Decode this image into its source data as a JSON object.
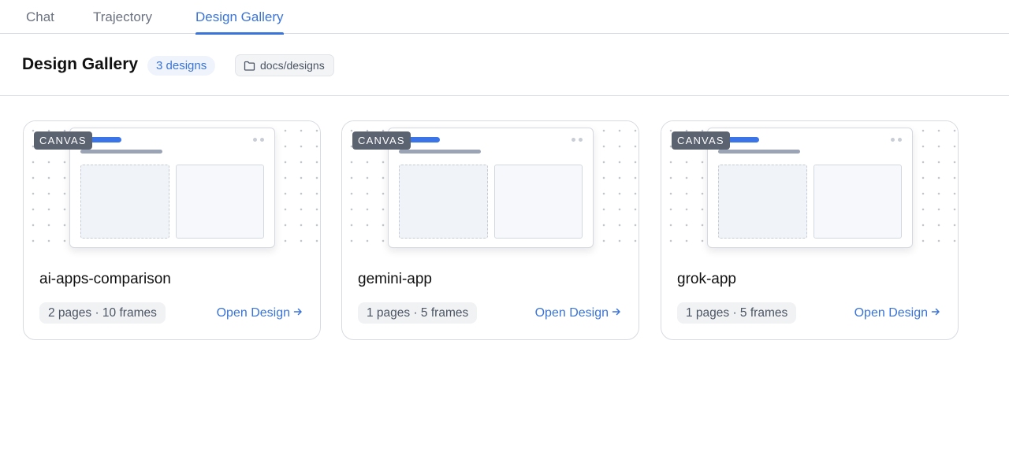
{
  "tabs": [
    {
      "label": "Chat",
      "active": false
    },
    {
      "label": "Trajectory",
      "active": false
    },
    {
      "label": "Design Gallery",
      "active": true
    }
  ],
  "header": {
    "title": "Design Gallery",
    "count_badge": "3 designs",
    "path": "docs/designs",
    "path_icon": "folder-icon"
  },
  "cards": [
    {
      "canvas_label": "CANVAS",
      "name": "ai-apps-comparison",
      "meta": "2 pages · 10 frames",
      "open_label": "Open Design",
      "open_icon": "arrow-right-icon"
    },
    {
      "canvas_label": "CANVAS",
      "name": "gemini-app",
      "meta": "1 pages · 5 frames",
      "open_label": "Open Design",
      "open_icon": "arrow-right-icon"
    },
    {
      "canvas_label": "CANVAS",
      "name": "grok-app",
      "meta": "1 pages · 5 frames",
      "open_label": "Open Design",
      "open_icon": "arrow-right-icon"
    }
  ],
  "colors": {
    "accent": "#3b74d8",
    "canvas_badge": "#5b6270",
    "border": "#d7dbe0"
  }
}
